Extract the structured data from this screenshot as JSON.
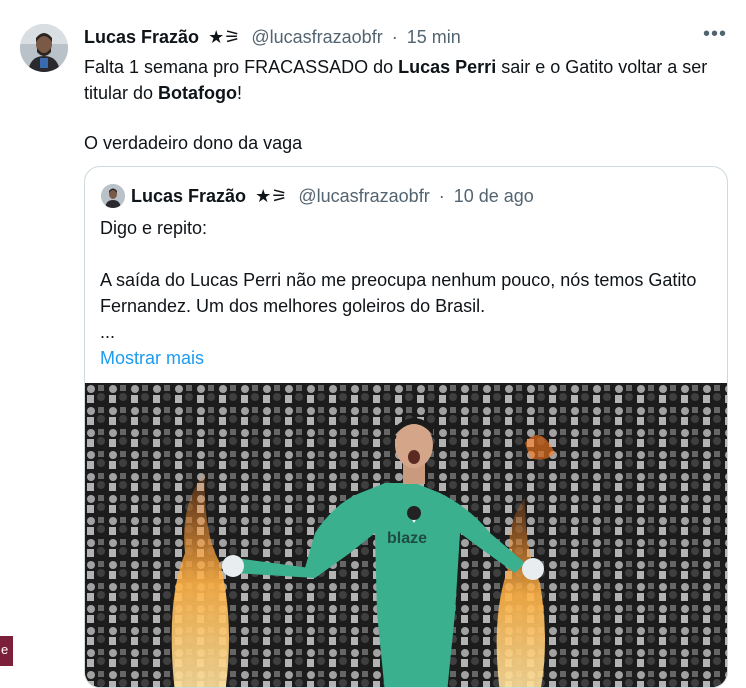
{
  "tweet": {
    "author": {
      "name": "Lucas Frazão",
      "badge": "★⚞",
      "handle": "@lucasfrazaobfr",
      "separator": "·",
      "time": "15 min"
    },
    "more_label": "•••",
    "text": {
      "t1": "Falta 1 semana pro FRACASSADO do ",
      "b1": "Lucas Perri",
      "t2": " sair e o Gatito voltar a ser titular do ",
      "b2": "Botafogo",
      "t3": "!",
      "p2": "O verdadeiro dono da vaga"
    },
    "quote": {
      "author": {
        "name": "Lucas Frazão",
        "badge": "★⚞",
        "handle": "@lucasfrazaobfr",
        "separator": "·",
        "time": "10 de ago"
      },
      "lines": {
        "l1": "Digo e repito:",
        "l2": "A saída do Lucas Perri não me preocupa nenhum pouco, nós temos Gatito Fernandez. Um dos melhores goleiros do Brasil.",
        "l3": "..."
      },
      "show_more": "Mostrar mais",
      "media": {
        "jersey_text": "blaze",
        "colors": {
          "jersey": "#3bb08f",
          "crowd": "#2a2a2a",
          "flame": "#ff9a3c"
        }
      }
    }
  },
  "corner_tab": {
    "label": "e"
  },
  "colors": {
    "link": "#1d9bf0",
    "secondary_text": "#536471",
    "border": "#cfd9de"
  }
}
